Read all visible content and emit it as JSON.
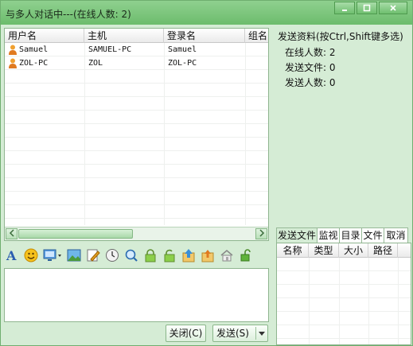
{
  "window": {
    "title": "与多人对话中---(在线人数: 2)",
    "controls": {
      "minimize_icon": "minimize-icon",
      "maximize_icon": "maximize-icon",
      "close_icon": "close-icon"
    }
  },
  "user_table": {
    "columns": [
      "用户名",
      "主机",
      "登录名",
      "组名"
    ],
    "rows": [
      {
        "username": "Samuel",
        "host": "SAMUEL-PC",
        "login": "Samuel",
        "group": ""
      },
      {
        "username": "ZOL-PC",
        "host": "ZOL",
        "login": "ZOL-PC",
        "group": ""
      }
    ]
  },
  "info": {
    "title": "发送资料(按Ctrl,Shift键多选)",
    "online_count": "在线人数: 2",
    "send_files": "发送文件: 0",
    "send_people": "发送人数: 0"
  },
  "toolbar": {
    "icons": [
      "font-icon",
      "emoji-icon",
      "screen-capture-icon",
      "image-icon",
      "edit-icon",
      "clock-icon",
      "search-icon",
      "lock-icon",
      "unlock-icon",
      "upload-icon",
      "upload-alt-icon",
      "home-icon",
      "padlock-open-icon"
    ]
  },
  "buttons": {
    "close_label": "关闭(C)",
    "send_label": "发送(S)"
  },
  "file_tabs": {
    "tabs": [
      "发送文件",
      "监视",
      "目录",
      "文件",
      "取消"
    ],
    "active": "发送文件"
  },
  "file_list": {
    "columns": [
      "名称",
      "类型",
      "大小",
      "路径"
    ]
  },
  "colors": {
    "window_bg": "#d5ecd5",
    "titlebar": "#7cc57c",
    "border": "#8fb58f"
  }
}
